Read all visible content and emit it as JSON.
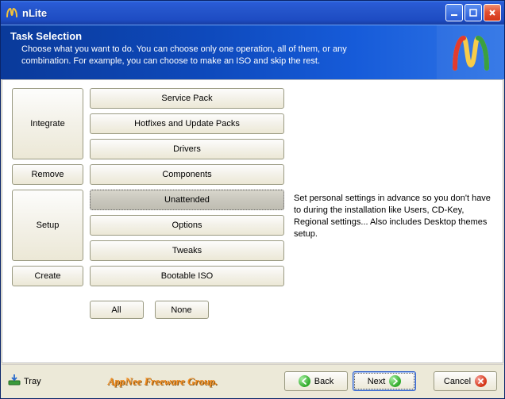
{
  "window": {
    "title": "nLite"
  },
  "header": {
    "title": "Task Selection",
    "subtitle": "Choose what you want to do. You can choose only one operation, all of them, or any combination. For example, you can choose to make an ISO and skip the rest."
  },
  "categories": {
    "integrate": "Integrate",
    "remove": "Remove",
    "setup": "Setup",
    "create": "Create"
  },
  "tasks": {
    "service_pack": "Service Pack",
    "hotfixes": "Hotfixes and Update Packs",
    "drivers": "Drivers",
    "components": "Components",
    "unattended": "Unattended",
    "options": "Options",
    "tweaks": "Tweaks",
    "bootable_iso": "Bootable ISO"
  },
  "description": "Set personal settings in advance so you don't have to during the installation like Users, CD-Key, Regional settings... Also includes Desktop themes setup.",
  "buttons": {
    "all": "All",
    "none": "None",
    "back": "Back",
    "next": "Next",
    "cancel": "Cancel"
  },
  "footer": {
    "tray": "Tray",
    "watermark": "AppNee Freeware Group."
  }
}
